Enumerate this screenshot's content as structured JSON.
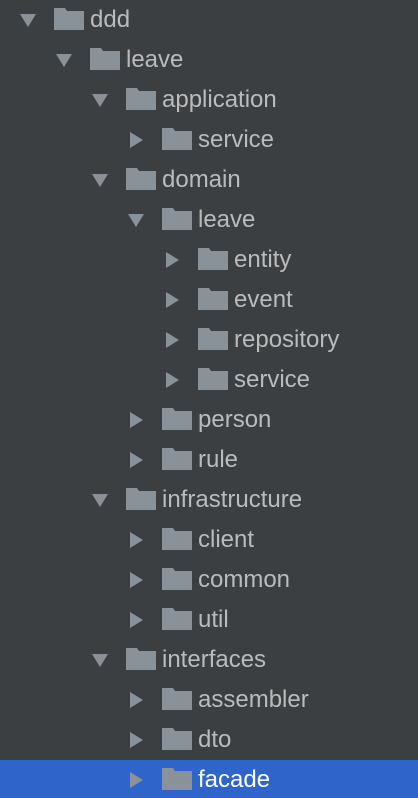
{
  "colors": {
    "background": "#3c3f41",
    "text": "#bbbbbb",
    "icon": "#8a9299",
    "selection": "#2f65ca",
    "selected_text": "#ffffff"
  },
  "icons": {
    "expanded": "chevron-down-icon",
    "collapsed": "chevron-right-icon",
    "folder": "folder-icon"
  },
  "tree": [
    {
      "label": "ddd",
      "depth": 0,
      "expanded": true
    },
    {
      "label": "leave",
      "depth": 1,
      "expanded": true
    },
    {
      "label": "application",
      "depth": 2,
      "expanded": true
    },
    {
      "label": "service",
      "depth": 3,
      "expanded": false
    },
    {
      "label": "domain",
      "depth": 2,
      "expanded": true
    },
    {
      "label": "leave",
      "depth": 3,
      "expanded": true
    },
    {
      "label": "entity",
      "depth": 4,
      "expanded": false
    },
    {
      "label": "event",
      "depth": 4,
      "expanded": false
    },
    {
      "label": "repository",
      "depth": 4,
      "expanded": false
    },
    {
      "label": "service",
      "depth": 4,
      "expanded": false
    },
    {
      "label": "person",
      "depth": 3,
      "expanded": false
    },
    {
      "label": "rule",
      "depth": 3,
      "expanded": false
    },
    {
      "label": "infrastructure",
      "depth": 2,
      "expanded": true
    },
    {
      "label": "client",
      "depth": 3,
      "expanded": false
    },
    {
      "label": "common",
      "depth": 3,
      "expanded": false
    },
    {
      "label": "util",
      "depth": 3,
      "expanded": false
    },
    {
      "label": "interfaces",
      "depth": 2,
      "expanded": true
    },
    {
      "label": "assembler",
      "depth": 3,
      "expanded": false
    },
    {
      "label": "dto",
      "depth": 3,
      "expanded": false
    },
    {
      "label": "facade",
      "depth": 3,
      "expanded": false,
      "selected": true
    }
  ]
}
